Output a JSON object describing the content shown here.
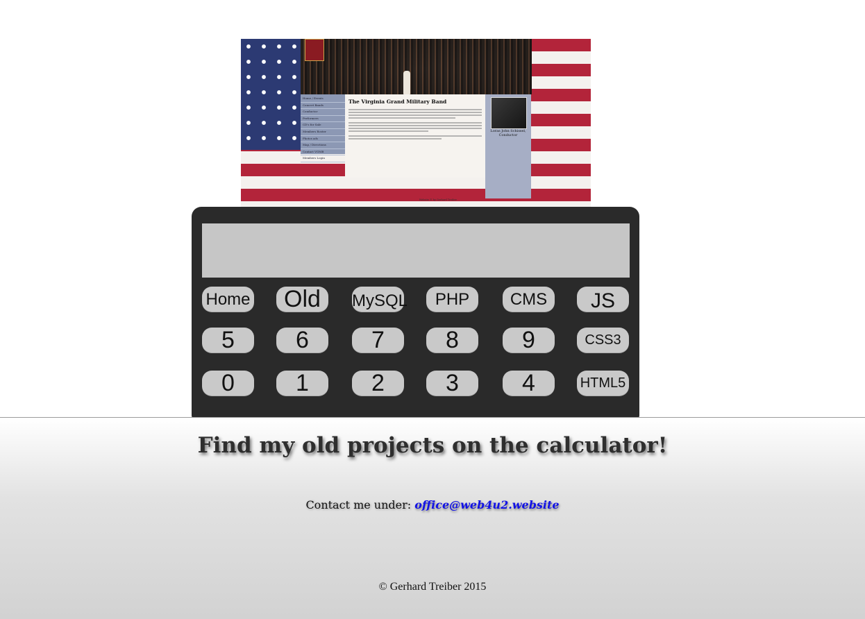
{
  "preview": {
    "site_title": "The Virginia Grand Military Band",
    "nav_items": [
      "Home / Events",
      "Concert Bands",
      "Conductor",
      "Performers",
      "CD's for Sale",
      "Members Roster",
      "Photos ads",
      "Map / Directions",
      "Contact VGMB",
      "Members Login"
    ],
    "conductor_caption": "Loras John Schissel, Conductor",
    "footer_text": "Website © by Gerhard Treiber"
  },
  "calculator": {
    "rows": [
      [
        "Home",
        "Old",
        "MySQL",
        "PHP",
        "CMS",
        "JS"
      ],
      [
        "5",
        "6",
        "7",
        "8",
        "9",
        "CSS3"
      ],
      [
        "0",
        "1",
        "2",
        "3",
        "4",
        "HTML5"
      ]
    ]
  },
  "footer": {
    "headline": "Find my old projects on the calculator!",
    "contact_label": "Contact me under:",
    "contact_email": "office@web4u2.website",
    "copyright": "© Gerhard Treiber 2015"
  }
}
